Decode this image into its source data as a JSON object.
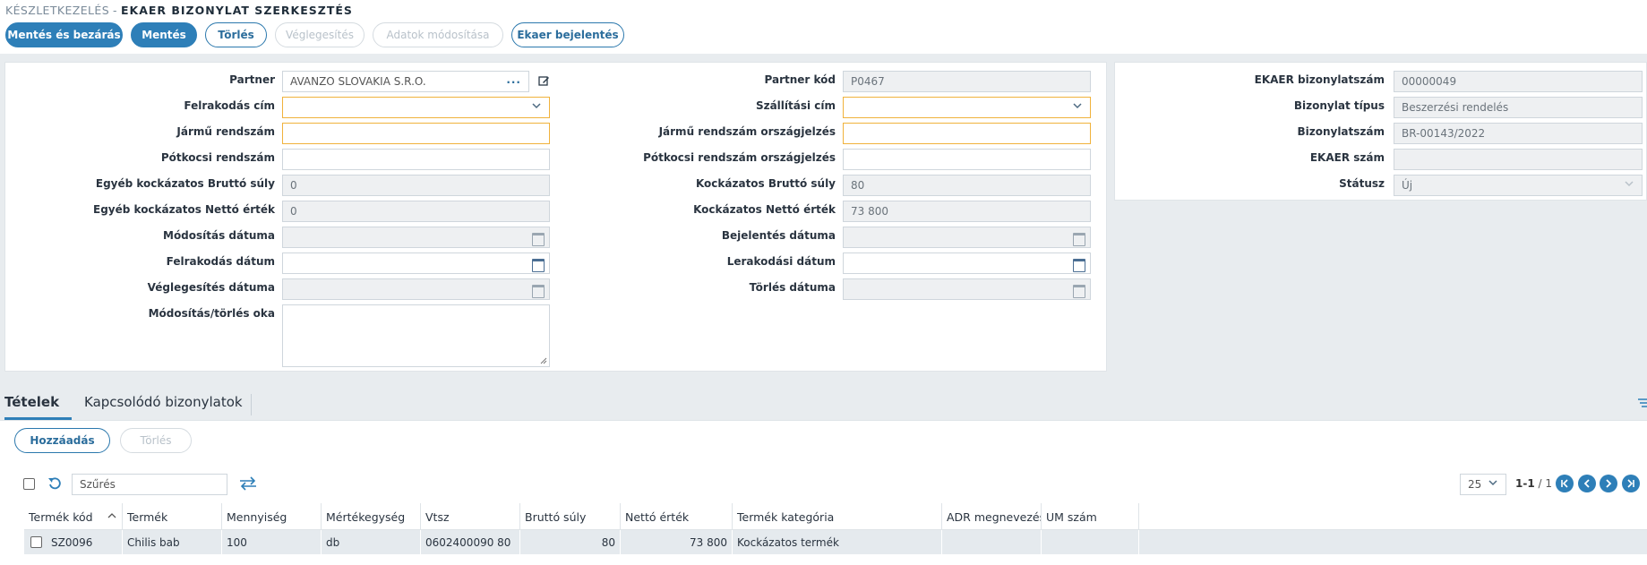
{
  "breadcrumb": {
    "module": "KÉSZLETKEZELÉS",
    "separator": "-",
    "page": "EKAER BIZONYLAT SZERKESZTÉS"
  },
  "toolbar": {
    "save_close": "Mentés és bezárás",
    "save": "Mentés",
    "delete": "Törlés",
    "finalize": "Véglegesítés",
    "modify_data": "Adatok módosítása",
    "ekaer_report": "Ekaer bejelentés"
  },
  "form": {
    "partner": {
      "label": "Partner",
      "value": "AVANZO SLOVAKIA S.R.O."
    },
    "loading_address": {
      "label": "Felrakodás cím",
      "value": ""
    },
    "vehicle_plate": {
      "label": "Jármű rendszám",
      "value": ""
    },
    "trailer_plate": {
      "label": "Pótkocsi rendszám",
      "value": ""
    },
    "other_risky_gross": {
      "label": "Egyéb kockázatos Bruttó súly",
      "value": "0"
    },
    "other_risky_net": {
      "label": "Egyéb kockázatos Nettó érték",
      "value": "0"
    },
    "modify_date": {
      "label": "Módosítás dátuma",
      "value": ""
    },
    "loading_date": {
      "label": "Felrakodás dátum",
      "value": ""
    },
    "finalize_date": {
      "label": "Véglegesítés dátuma",
      "value": ""
    },
    "modify_delete_reason": {
      "label": "Módosítás/törlés oka",
      "value": ""
    },
    "partner_code": {
      "label": "Partner kód",
      "value": "P0467"
    },
    "delivery_address": {
      "label": "Szállítási cím",
      "value": ""
    },
    "vehicle_plate_country": {
      "label": "Jármű rendszám országjelzés",
      "value": ""
    },
    "trailer_plate_country": {
      "label": "Pótkocsi rendszám országjelzés",
      "value": ""
    },
    "risky_gross": {
      "label": "Kockázatos Bruttó súly",
      "value": "80"
    },
    "risky_net": {
      "label": "Kockázatos Nettó érték",
      "value": "73 800"
    },
    "report_date": {
      "label": "Bejelentés dátuma",
      "value": ""
    },
    "unloading_date": {
      "label": "Lerakodási dátum",
      "value": ""
    },
    "delete_date": {
      "label": "Törlés dátuma",
      "value": ""
    }
  },
  "side": {
    "ekaer_doc_no": {
      "label": "EKAER bizonylatszám",
      "value": "00000049"
    },
    "doc_type": {
      "label": "Bizonylat típus",
      "value": "Beszerzési rendelés"
    },
    "doc_no": {
      "label": "Bizonylatszám",
      "value": "BR-00143/2022"
    },
    "ekaer_no": {
      "label": "EKAER szám",
      "value": ""
    },
    "status": {
      "label": "Státusz",
      "value": "Új"
    }
  },
  "tabs": [
    "Tételek",
    "Kapcsolódó bizonylatok"
  ],
  "grid": {
    "add": "Hozzáadás",
    "delete": "Törlés",
    "filter_placeholder": "Szűrés",
    "page_size": "25",
    "page_range": "1-1",
    "page_total": "/ 1",
    "columns": [
      "Termék kód",
      "Termék",
      "Mennyiség",
      "Mértékegység",
      "Vtsz",
      "Bruttó súly",
      "Nettó érték",
      "Termék kategória",
      "ADR megnevezés",
      "UM szám"
    ],
    "rows": [
      [
        "SZ0096",
        "Chilis bab",
        "100",
        "db",
        "0602400090 80",
        "80",
        "73 800",
        "Kockázatos termék",
        "",
        ""
      ]
    ]
  },
  "colors": {
    "primary": "#2e7fb8",
    "required_border": "#f0b23c",
    "readonly_bg": "#eef0f2"
  }
}
